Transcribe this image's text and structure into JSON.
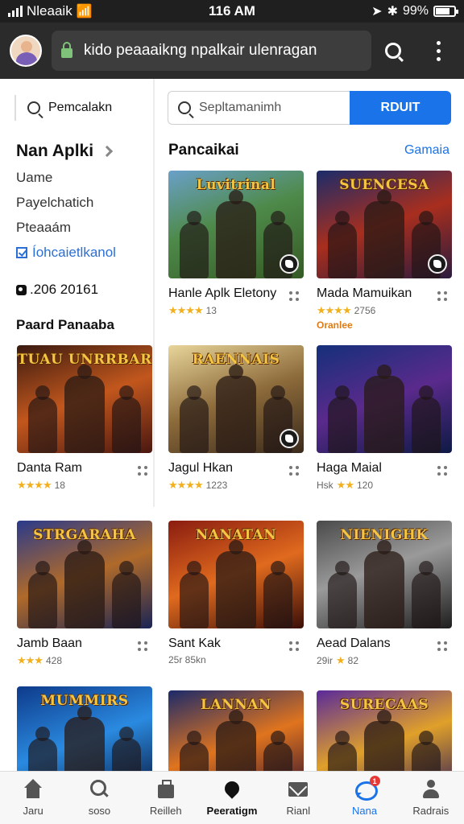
{
  "status_bar": {
    "carrier": "Nleaaik",
    "time": "116 AM",
    "battery": "99%"
  },
  "app_bar": {
    "url": "kido peaaaikng npalkair ulenragan"
  },
  "sidebar": {
    "search_label": "Pemcalakn",
    "title": "Nan Aplki",
    "items": [
      {
        "label": "Uame"
      },
      {
        "label": "Payelchatich"
      },
      {
        "label": "Pteaaám"
      }
    ],
    "checked_item": "Íohcaietlkanol",
    "stat": ".206 20161",
    "section": "Paard Panaaba"
  },
  "search": {
    "placeholder": "Sepltamanimh",
    "button": "RDUIT"
  },
  "section": {
    "title": "Pancaikai",
    "link": "Gamaia"
  },
  "cards": [
    {
      "title": "Hanle Aplk Eletony",
      "rating": "★★★★",
      "meta": "13",
      "logo": "Luvitrinal",
      "bg": "linear-gradient(160deg,#6aa0c9 0%,#4e8a4a 45%,#355a25 100%)",
      "badge": true
    },
    {
      "title": "Mada Mamuikan",
      "rating": "★★★★",
      "meta": "2756",
      "note": "Oranlee",
      "logo": "SUENCESA",
      "bg": "linear-gradient(160deg,#1b2c6a 0%,#a82e1e 50%,#2a1c3e 100%)",
      "badge": true
    },
    {
      "title": "Danta Ram",
      "rating": "★★★★",
      "meta": "18",
      "logo": "TUAU UNRRBAR",
      "bg": "linear-gradient(160deg,#3a1a10 0%,#c2571d 50%,#4a1710 100%)"
    },
    {
      "title": "Jagul Hkan",
      "rating": "★★★★",
      "meta": "1223",
      "logo": "RAENNAIS",
      "bg": "linear-gradient(160deg,#e8d59a 0%,#8c6a3a 50%,#3a2a1c 100%)",
      "badge": true
    },
    {
      "title": "Haga Maial",
      "rating": "★★",
      "meta": "120",
      "prefix": "Hsk",
      "logo": "",
      "bg": "linear-gradient(160deg,#15307a 0%,#5a2a8c 50%,#0e1a45 100%)"
    },
    {
      "title": "Jamb Baan",
      "rating": "★★★",
      "meta": "428",
      "logo": "STRGARAHA",
      "bg": "linear-gradient(160deg,#2a3a8a 0%,#b06a2a 50%,#1a2455 100%)"
    },
    {
      "title": "Sant Kak",
      "rating": "",
      "meta": "25r 85kn",
      "logo": "NANATAN",
      "bg": "linear-gradient(160deg,#8a1c10 0%,#e06a1e 50%,#3a0e08 100%)"
    },
    {
      "title": "Aead Dalans",
      "rating": "★",
      "meta": "82",
      "prefix": "29ir",
      "logo": "NIENIGHK",
      "bg": "linear-gradient(160deg,#4a4a4a 0%,#9a9a9a 45%,#1e1e1e 100%)"
    },
    {
      "title": "",
      "rating": "",
      "meta": "",
      "logo": "MUMMIRS",
      "bg": "linear-gradient(160deg,#0e3a8a 0%,#2a8ae0 50%,#0a1a40 100%)"
    },
    {
      "title": "",
      "rating": "",
      "meta": "",
      "logo": "LANNAN",
      "bg": "linear-gradient(160deg,#1c2a6a 0%,#e0741e 50%,#2a0e30 100%)"
    },
    {
      "title": "",
      "rating": "",
      "meta": "",
      "logo": "SURECAAS",
      "bg": "linear-gradient(160deg,#5a2a9a 0%,#e0a02a 50%,#2a1a5a 100%)"
    }
  ],
  "bottom_nav": [
    {
      "label": "Jaru",
      "icon": "home-icon"
    },
    {
      "label": "soso",
      "icon": "search-icon"
    },
    {
      "label": "Reilleh",
      "icon": "bag-icon"
    },
    {
      "label": "Peeratigm",
      "icon": "drop-icon"
    },
    {
      "label": "Rianl",
      "icon": "mail-icon"
    },
    {
      "label": "Nana",
      "icon": "chat-icon",
      "badge": "1"
    },
    {
      "label": "Radrais",
      "icon": "person-icon"
    }
  ],
  "colors": {
    "accent": "#1a73e8",
    "star": "#f2b01e",
    "app_bar": "#2b2b2b"
  }
}
